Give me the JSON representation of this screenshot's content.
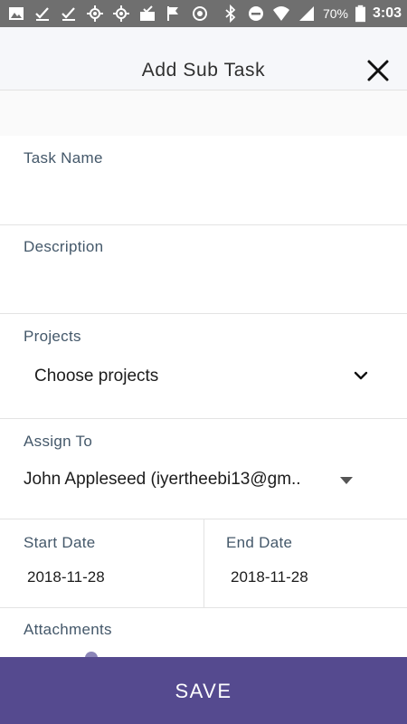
{
  "status_bar": {
    "battery_percent": "70%",
    "time": "3:03",
    "left_icons": [
      "image-icon",
      "check-icon",
      "check-icon",
      "gps-icon",
      "gps-icon",
      "inbox-check-icon",
      "flag-icon",
      "target-icon"
    ],
    "right_icons": [
      "bluetooth-icon",
      "do-not-disturb-icon",
      "wifi-icon",
      "signal-icon",
      "battery-icon"
    ]
  },
  "header": {
    "title": "Add Sub Task",
    "close_icon": "close-icon"
  },
  "form": {
    "task_name": {
      "label": "Task Name",
      "value": ""
    },
    "description": {
      "label": "Description",
      "value": ""
    },
    "projects": {
      "label": "Projects",
      "selected": "Choose projects",
      "icon": "chevron-down-icon"
    },
    "assign_to": {
      "label": "Assign To",
      "selected": "John Appleseed (iyertheebi13@gm..",
      "icon": "dropdown-caret-icon"
    },
    "start_date": {
      "label": "Start Date",
      "value": "2018-11-28"
    },
    "end_date": {
      "label": "End Date",
      "value": "2018-11-28"
    },
    "attachments": {
      "label": "Attachments"
    }
  },
  "footer": {
    "save_label": "SAVE"
  },
  "colors": {
    "accent": "#554a8f",
    "label": "#44586a",
    "status_bar": "#6f6f6f"
  }
}
